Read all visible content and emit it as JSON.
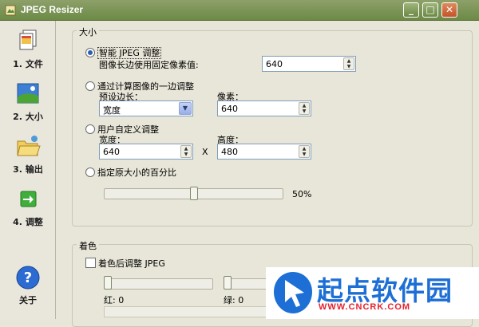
{
  "window": {
    "title": "JPEG Resizer",
    "min": "_",
    "max": "□",
    "close": "✕"
  },
  "sidebar": {
    "items": [
      {
        "label": "1. 文件",
        "icon": "documents-icon"
      },
      {
        "label": "2. 大小",
        "icon": "picture-icon"
      },
      {
        "label": "3. 输出",
        "icon": "folder-icon"
      },
      {
        "label": "4. 调整",
        "icon": "arrow-right-icon"
      }
    ],
    "about": "关于"
  },
  "size_group": {
    "legend": "大小",
    "smart": {
      "label": "智能 JPEG 调整",
      "sub": "图像长边使用固定像素值:",
      "value": "640",
      "selected": true
    },
    "calc": {
      "label": "通过计算图像的一边调整",
      "preset_label": "预设边长：",
      "preset_value": "宽度",
      "pixels_label": "像素：",
      "pixels_value": "640",
      "selected": false
    },
    "custom": {
      "label": "用户自定义调整",
      "width_label": "宽度：",
      "width_value": "640",
      "x": "X",
      "height_label": "高度：",
      "height_value": "480",
      "selected": false
    },
    "percent": {
      "label": "指定原大小的百分比",
      "value": "50%",
      "level": 50,
      "selected": false
    }
  },
  "color_group": {
    "legend": "着色",
    "check_label": "着色后调整 JPEG",
    "checked": false,
    "red_label": "红: 0",
    "green_label": "绿: 0"
  },
  "watermark": {
    "text": "起点软件园",
    "url": "WWW.CNCRK.COM"
  },
  "colors": {
    "titlebar": "#6c8a45",
    "accent": "#2a5fb0",
    "watermark_blue": "#1d6fd6",
    "watermark_red": "#e6202d"
  }
}
